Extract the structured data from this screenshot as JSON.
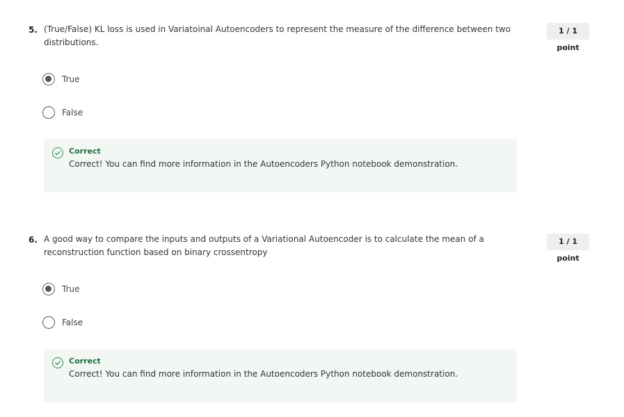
{
  "questions": [
    {
      "number": "5.",
      "text": "(True/False) KL loss is used in Variatoinal Autoencoders to represent the measure of the difference between two distributions.",
      "points": "1 / 1 point",
      "options": [
        {
          "label": "True",
          "selected": true
        },
        {
          "label": "False",
          "selected": false
        }
      ],
      "feedback": {
        "title": "Correct",
        "text": "Correct! You can find more information in the Autoencoders Python notebook demonstration."
      }
    },
    {
      "number": "6.",
      "text": "A good way to compare the inputs and outputs of a Variational Autoencoder is to calculate the mean of a reconstruction function based on binary crossentropy",
      "points": "1 / 1 point",
      "options": [
        {
          "label": "True",
          "selected": true
        },
        {
          "label": "False",
          "selected": false
        }
      ],
      "feedback": {
        "title": "Correct",
        "text": "Correct! You can find more information in the Autoencoders Python notebook demonstration."
      }
    }
  ],
  "colors": {
    "correct_green": "#1d6b3e",
    "feedback_bg": "#f2f7f4",
    "points_bg": "#eeeeee"
  },
  "icons": {
    "feedback": "check-circle-icon"
  }
}
